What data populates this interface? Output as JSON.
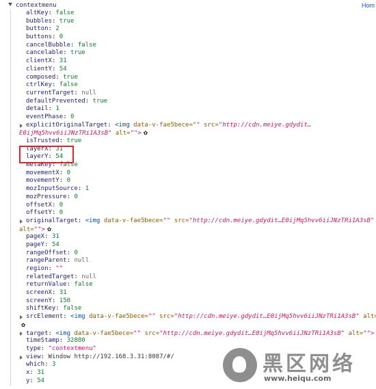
{
  "corner_text": "Hom",
  "root": {
    "title": "contextmenu"
  },
  "props": [
    {
      "k": "altKey",
      "v": "false",
      "t": "bool"
    },
    {
      "k": "bubbles",
      "v": "true",
      "t": "bool"
    },
    {
      "k": "button",
      "v": "2",
      "t": "num"
    },
    {
      "k": "buttons",
      "v": "0",
      "t": "num"
    },
    {
      "k": "cancelBubble",
      "v": "false",
      "t": "bool"
    },
    {
      "k": "cancelable",
      "v": "true",
      "t": "bool"
    },
    {
      "k": "clientX",
      "v": "31",
      "t": "num"
    },
    {
      "k": "clientY",
      "v": "54",
      "t": "num"
    },
    {
      "k": "composed",
      "v": "true",
      "t": "bool"
    },
    {
      "k": "ctrlKey",
      "v": "false",
      "t": "bool"
    },
    {
      "k": "currentTarget",
      "v": "null",
      "t": "null"
    },
    {
      "k": "defaultPrevented",
      "v": "true",
      "t": "bool"
    },
    {
      "k": "detail",
      "v": "1",
      "t": "num"
    },
    {
      "k": "eventPhase",
      "v": "0",
      "t": "num"
    }
  ],
  "explicitOriginalTarget": {
    "k": "explicitOriginalTarget",
    "tag": "<img",
    "attr1": "data-v-fae5bece=",
    "val1": "\"\"",
    "attr2": "src=",
    "val2": "\"http://cdn.meiye.gdydit…",
    "cont_val": "E0ijMq5hvv6iiJNzTRi1A3sB\"",
    "cont_attr": "alt=",
    "cont_end": "\"\">"
  },
  "props2": [
    {
      "k": "isTrusted",
      "v": "true",
      "t": "bool"
    },
    {
      "k": "layerX",
      "v": "31",
      "t": "num"
    },
    {
      "k": "layerY",
      "v": "54",
      "t": "num"
    },
    {
      "k": "metaKey",
      "v": "false",
      "t": "bool"
    },
    {
      "k": "movementX",
      "v": "0",
      "t": "num"
    },
    {
      "k": "movementY",
      "v": "0",
      "t": "num"
    },
    {
      "k": "mozInputSource",
      "v": "1",
      "t": "num"
    },
    {
      "k": "mozPressure",
      "v": "0",
      "t": "num"
    },
    {
      "k": "offsetX",
      "v": "0",
      "t": "num"
    },
    {
      "k": "offsetY",
      "v": "0",
      "t": "num"
    }
  ],
  "originalTarget": {
    "k": "originalTarget",
    "tag": "<img",
    "attr1": "data-v-fae5bece=",
    "val1": "\"\"",
    "attr2": "src=",
    "val2": "\"http://cdn.meiye.gdydit…E0ijMq5hvv6iiJNzTRi1A3sB\"",
    "cont_attr": "alt=",
    "cont_end": "\"\">"
  },
  "props3": [
    {
      "k": "pageX",
      "v": "31",
      "t": "num"
    },
    {
      "k": "pageY",
      "v": "54",
      "t": "num"
    },
    {
      "k": "rangeOffset",
      "v": "0",
      "t": "num"
    },
    {
      "k": "rangeParent",
      "v": "null",
      "t": "null"
    },
    {
      "k": "region",
      "v": "\"\"",
      "t": "str"
    },
    {
      "k": "relatedTarget",
      "v": "null",
      "t": "null"
    },
    {
      "k": "returnValue",
      "v": "false",
      "t": "bool"
    },
    {
      "k": "screenX",
      "v": "31",
      "t": "num"
    },
    {
      "k": "screenY",
      "v": "150",
      "t": "num"
    },
    {
      "k": "shiftKey",
      "v": "false",
      "t": "bool"
    }
  ],
  "srcElement": {
    "k": "srcElement",
    "tag": "<img",
    "attr1": "data-v-fae5bece=",
    "val1": "\"\"",
    "attr2": "src=",
    "val2": "\"http://cdn.meiye.gdydit…E0ijMq5hvv6iiJNzTRi1A3sB\"",
    "attr3": "alt=",
    "end": "\"\">"
  },
  "target": {
    "k": "target",
    "tag": "<img",
    "attr1": "data-v-fae5bece=",
    "val1": "\"\"",
    "attr2": "src=",
    "val2": "\"http://cdn.meiye.gdydit…E0ijMq5hvv6iiJNzTRi1A3sB\"",
    "attr3": "alt=",
    "end": "\"\">"
  },
  "props4": [
    {
      "k": "timeStamp",
      "v": "32880",
      "t": "num"
    },
    {
      "k": "type",
      "v": "\"contextmenu\"",
      "t": "str"
    }
  ],
  "view": {
    "k": "view",
    "v": "Window http://192.168.3.31:8087/#/"
  },
  "props5": [
    {
      "k": "which",
      "v": "3",
      "t": "num"
    },
    {
      "k": "x",
      "v": "31",
      "t": "num"
    },
    {
      "k": "y",
      "v": "54",
      "t": "num"
    }
  ],
  "watermark": {
    "title": "黑区网络",
    "url": "www.heiqu.com"
  },
  "colors": {
    "highlight": "#e0212b",
    "key": "#1f1f6f",
    "bool": "#0f7a2e",
    "string": "#c21a64"
  }
}
